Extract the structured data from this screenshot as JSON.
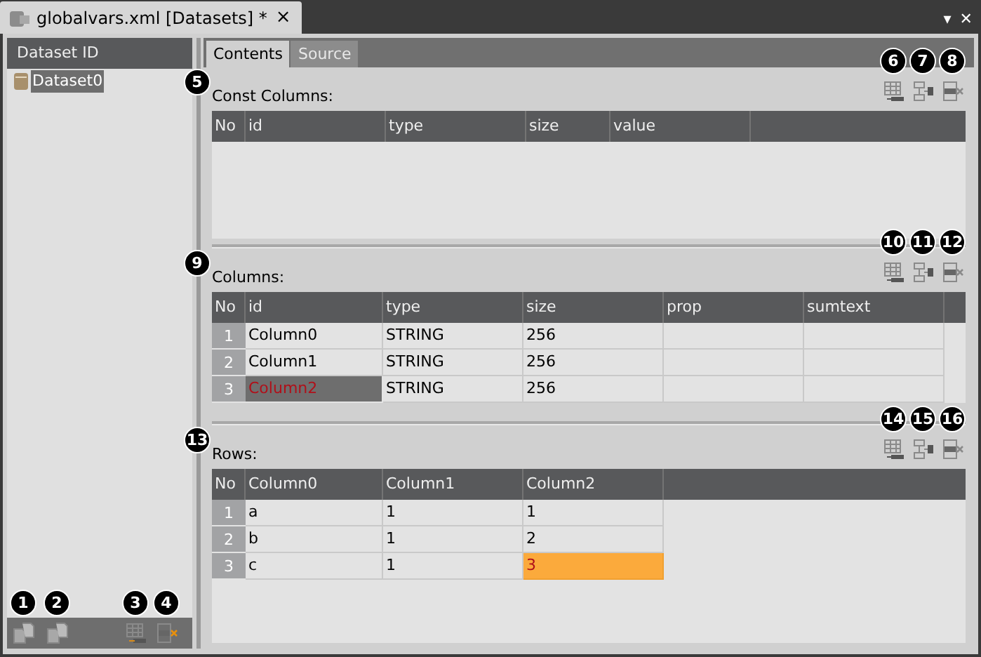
{
  "document_tab": {
    "title": "globalvars.xml [Datasets] *",
    "close": "×"
  },
  "window_controls": [
    "▾",
    "✕"
  ],
  "sidebar": {
    "header": "Dataset ID",
    "items": [
      {
        "label": "Dataset0",
        "selected": true
      }
    ],
    "buttons": [
      {
        "kind": "copy",
        "callout": "1"
      },
      {
        "kind": "paste",
        "callout": "2"
      },
      {
        "kind": "add",
        "callout": "3"
      },
      {
        "kind": "delete",
        "callout": "4"
      }
    ]
  },
  "tabs": [
    {
      "label": "Contents",
      "selected": true
    },
    {
      "label": "Source",
      "selected": false
    }
  ],
  "sections": [
    {
      "label": "Const Columns:",
      "callout": "5",
      "buttons": [
        {
          "kind": "add-row",
          "callout": "6"
        },
        {
          "kind": "insert-row",
          "callout": "7"
        },
        {
          "kind": "delete-row",
          "callout": "8"
        }
      ],
      "columns": [
        "No",
        "id",
        "type",
        "size",
        "value"
      ]
    },
    {
      "label": "Columns:",
      "callout": "9",
      "buttons": [
        {
          "kind": "add-row",
          "callout": "10"
        },
        {
          "kind": "insert-row",
          "callout": "11"
        },
        {
          "kind": "delete-row",
          "callout": "12"
        }
      ],
      "columns": [
        "No",
        "id",
        "type",
        "size",
        "prop",
        "sumtext"
      ],
      "rows": [
        {
          "cells": [
            {
              "text": "1",
              "selected": false,
              "modified": false
            },
            {
              "text": "Column0",
              "selected": false,
              "modified": false
            },
            {
              "text": "STRING",
              "selected": false,
              "modified": false
            },
            {
              "text": "256",
              "selected": false,
              "modified": false
            },
            {
              "text": "",
              "selected": false,
              "modified": false
            },
            {
              "text": "",
              "selected": false,
              "modified": false
            }
          ]
        },
        {
          "cells": [
            {
              "text": "2",
              "selected": false,
              "modified": false
            },
            {
              "text": "Column1",
              "selected": false,
              "modified": false
            },
            {
              "text": "STRING",
              "selected": false,
              "modified": false
            },
            {
              "text": "256",
              "selected": false,
              "modified": false
            },
            {
              "text": "",
              "selected": false,
              "modified": false
            },
            {
              "text": "",
              "selected": false,
              "modified": false
            }
          ]
        },
        {
          "cells": [
            {
              "text": "3",
              "selected": false,
              "modified": false
            },
            {
              "text": "Column2",
              "selected": true,
              "modified": false
            },
            {
              "text": "STRING",
              "selected": false,
              "modified": false
            },
            {
              "text": "256",
              "selected": false,
              "modified": false
            },
            {
              "text": "",
              "selected": false,
              "modified": false
            },
            {
              "text": "",
              "selected": false,
              "modified": false
            }
          ]
        }
      ]
    },
    {
      "label": "Rows:",
      "callout": "13",
      "buttons": [
        {
          "kind": "add-row",
          "callout": "14"
        },
        {
          "kind": "insert-row",
          "callout": "15"
        },
        {
          "kind": "delete-row",
          "callout": "16"
        }
      ],
      "columns": [
        "No",
        "Column0",
        "Column1",
        "Column2"
      ],
      "rows": [
        {
          "cells": [
            {
              "text": "1",
              "selected": false,
              "modified": false
            },
            {
              "text": "a",
              "selected": false,
              "modified": false
            },
            {
              "text": "1",
              "selected": false,
              "modified": false
            },
            {
              "text": "1",
              "selected": false,
              "modified": false
            }
          ]
        },
        {
          "cells": [
            {
              "text": "2",
              "selected": false,
              "modified": false
            },
            {
              "text": "b",
              "selected": false,
              "modified": false
            },
            {
              "text": "1",
              "selected": false,
              "modified": false
            },
            {
              "text": "2",
              "selected": false,
              "modified": false
            }
          ]
        },
        {
          "cells": [
            {
              "text": "3",
              "selected": false,
              "modified": false
            },
            {
              "text": "c",
              "selected": false,
              "modified": false
            },
            {
              "text": "1",
              "selected": false,
              "modified": false
            },
            {
              "text": "3",
              "selected": false,
              "modified": true
            }
          ]
        }
      ]
    }
  ]
}
